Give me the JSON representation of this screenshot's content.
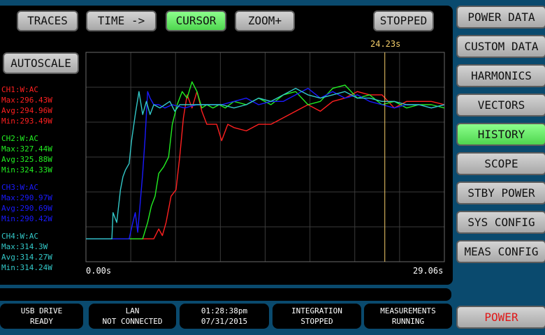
{
  "toolbar": {
    "traces": "TRACES",
    "time": "TIME ->",
    "cursor": "CURSOR",
    "zoom": "ZOOM+",
    "stopped": "STOPPED",
    "autoscale": "AUTOSCALE"
  },
  "cursor_readout": "24.23s",
  "axis": {
    "start": "0.00s",
    "end": "29.06s"
  },
  "channels": [
    {
      "title": "CH1:W:AC",
      "max": "Max:296.43W",
      "avg": "Avg:294.96W",
      "min": "Min:293.49W",
      "color": "#ff2020"
    },
    {
      "title": "CH2:W:AC",
      "max": "Max:327.44W",
      "avg": "Avg:325.88W",
      "min": "Min:324.33W",
      "color": "#22ee22"
    },
    {
      "title": "CH3:W:AC",
      "max": "Max:290.97W",
      "avg": "Avg:290.69W",
      "min": "Min:290.42W",
      "color": "#1a1aff"
    },
    {
      "title": "CH4:W:AC",
      "max": "Max:314.3W",
      "avg": "Avg:314.27W",
      "min": "Min:314.24W",
      "color": "#33c8c8"
    }
  ],
  "side_menu": {
    "power_data": "POWER DATA",
    "custom_data": "CUSTOM DATA",
    "harmonics": "HARMONICS",
    "vectors": "VECTORS",
    "history": "HISTORY",
    "scope": "SCOPE",
    "stby_power": "STBY POWER",
    "sys_config": "SYS CONFIG",
    "meas_config": "MEAS CONFIG",
    "power": "POWER"
  },
  "status_bar": {
    "usb_line1": "USB DRIVE",
    "usb_line2": "READY",
    "lan_line1": "LAN",
    "lan_line2": "NOT CONNECTED",
    "time_line1": "01:28:38pm",
    "time_line2": "07/31/2015",
    "integ_line1": "INTEGRATION",
    "integ_line2": "STOPPED",
    "meas_line1": "MEASUREMENTS",
    "meas_line2": "RUNNING"
  },
  "chart_data": {
    "type": "line",
    "x_range": [
      0.0,
      29.06
    ],
    "cursor_x": 24.23,
    "grid": true,
    "series": [
      {
        "name": "CH1:W:AC",
        "color": "#ff2020",
        "x": [
          0,
          5.5,
          5.9,
          6.2,
          6.5,
          6.9,
          7.3,
          7.6,
          7.9,
          8.2,
          8.6,
          9.0,
          9.4,
          9.8,
          10.2,
          10.6,
          11.0,
          11.5,
          12.0,
          13,
          14,
          15,
          16,
          17,
          18,
          19,
          20,
          21,
          22,
          23,
          24,
          25,
          26,
          27,
          28,
          29.06
        ],
        "y": [
          292.5,
          292.5,
          292.8,
          292.6,
          293.0,
          293.8,
          294.0,
          295.0,
          296.2,
          296.9,
          296.5,
          297.0,
          296.4,
          296.0,
          296.0,
          296.0,
          295.5,
          296.0,
          295.9,
          295.8,
          296.0,
          296.0,
          296.2,
          296.4,
          296.6,
          296.4,
          296.7,
          296.8,
          297.0,
          296.9,
          296.9,
          296.5,
          296.7,
          296.7,
          296.7,
          296.6
        ]
      },
      {
        "name": "CH2:W:AC",
        "color": "#22ee22",
        "x": [
          0,
          4.6,
          5.0,
          5.3,
          5.6,
          5.9,
          6.3,
          6.7,
          7.0,
          7.4,
          7.8,
          8.2,
          8.6,
          9.0,
          9.4,
          9.8,
          10.3,
          10.8,
          11.3,
          12,
          13,
          14,
          15,
          16,
          17,
          18,
          19,
          20,
          21,
          22,
          23,
          24,
          25,
          26,
          27,
          28,
          29.06
        ],
        "y": [
          292.5,
          292.5,
          293.0,
          293.5,
          293.8,
          294.5,
          294.7,
          295.0,
          296.0,
          296.6,
          297.0,
          296.8,
          297.3,
          297.0,
          296.5,
          296.6,
          296.5,
          296.6,
          296.5,
          296.7,
          296.6,
          296.8,
          296.6,
          296.9,
          297.0,
          296.6,
          296.7,
          297.1,
          297.2,
          296.8,
          296.9,
          296.6,
          296.7,
          296.5,
          296.6,
          296.6,
          296.5
        ]
      },
      {
        "name": "CH3:W:AC",
        "color": "#1a1aff",
        "x": [
          0,
          3.5,
          3.8,
          4.0,
          4.2,
          4.4,
          4.6,
          4.8,
          5.0,
          5.2,
          5.5,
          5.9,
          6.4,
          7,
          8,
          9,
          10,
          11,
          12,
          13,
          14,
          15,
          16,
          17,
          18,
          19,
          20,
          21,
          22,
          23,
          24,
          25,
          26,
          27,
          28,
          29.06
        ],
        "y": [
          292.5,
          292.5,
          293.0,
          293.3,
          292.7,
          293.6,
          294.5,
          295.6,
          297.0,
          296.8,
          296.6,
          296.6,
          296.5,
          296.6,
          296.5,
          296.6,
          296.6,
          296.6,
          296.7,
          296.8,
          296.6,
          296.7,
          296.7,
          296.9,
          297.1,
          296.8,
          297.0,
          296.8,
          296.9,
          296.7,
          296.6,
          296.5,
          296.6,
          296.6,
          296.5,
          296.6
        ]
      },
      {
        "name": "CH4:W:AC",
        "color": "#33c8c8",
        "x": [
          0,
          2.1,
          2.2,
          2.5,
          2.8,
          3.0,
          3.2,
          3.5,
          3.7,
          4.0,
          4.3,
          4.6,
          4.9,
          5.2,
          5.5,
          6.0,
          6.4,
          6.8,
          7.2,
          7.6,
          8.0,
          8.5,
          9,
          10,
          11,
          12,
          13,
          14,
          15,
          16,
          17,
          18,
          19,
          20,
          21,
          22,
          23,
          24,
          25,
          26,
          27,
          28,
          29.06
        ],
        "y": [
          292.5,
          292.5,
          293.3,
          293.0,
          294.0,
          294.4,
          294.6,
          294.8,
          295.5,
          296.3,
          297.0,
          296.3,
          296.7,
          296.3,
          296.6,
          296.5,
          296.6,
          296.7,
          296.4,
          296.6,
          296.6,
          296.6,
          296.6,
          296.6,
          296.6,
          296.5,
          296.6,
          296.8,
          296.7,
          296.9,
          297.1,
          296.9,
          296.8,
          296.9,
          297.0,
          296.8,
          296.8,
          296.7,
          296.7,
          296.6,
          296.6,
          296.5,
          296.6
        ]
      }
    ]
  }
}
